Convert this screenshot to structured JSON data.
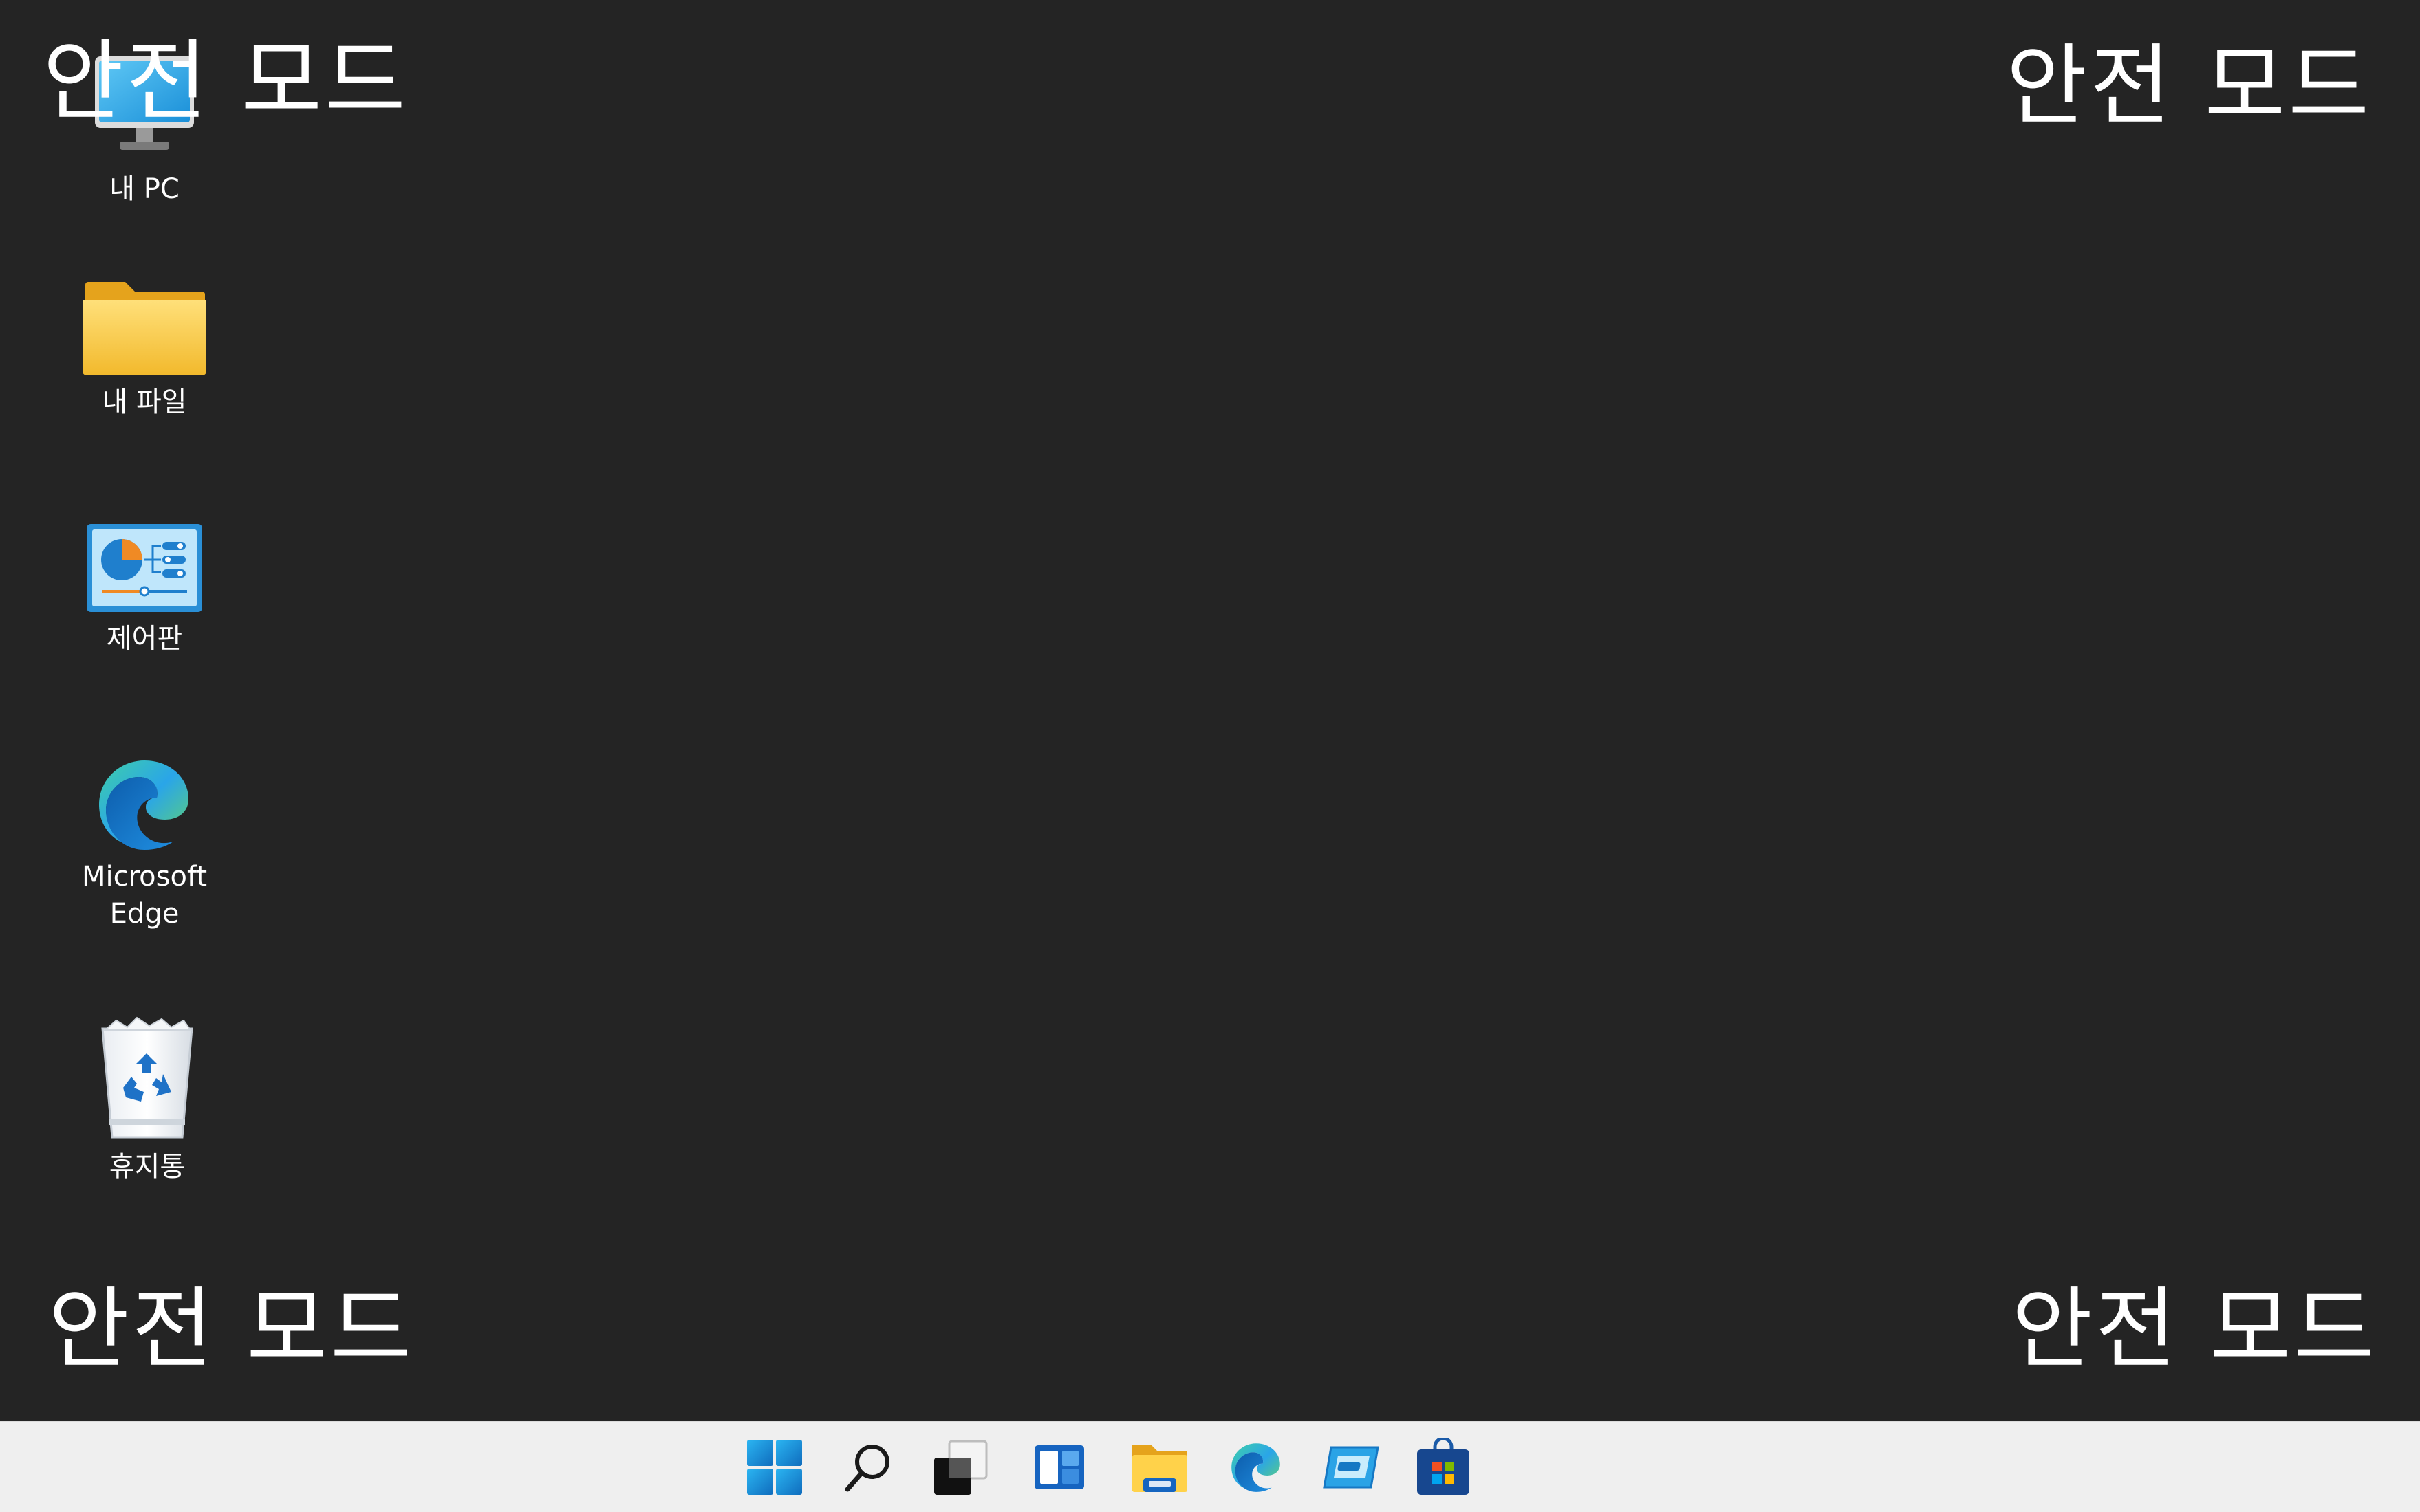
{
  "watermarks": {
    "top_left": "안전 모드",
    "top_right": "안전 모드",
    "bottom_left": "안전 모드",
    "bottom_right": "안전 모드"
  },
  "desktop_icons": [
    {
      "label": "내 PC",
      "icon": "computer-monitor-icon"
    },
    {
      "label": "내 파일",
      "icon": "folder-icon"
    },
    {
      "label": "제어판",
      "icon": "control-panel-icon"
    },
    {
      "label": "Microsoft Edge",
      "icon": "edge-icon"
    },
    {
      "label": "휴지통",
      "icon": "recycle-bin-icon"
    }
  ],
  "taskbar": {
    "items": [
      "start-icon",
      "search-icon",
      "task-view-icon",
      "widgets-icon",
      "file-explorer-icon",
      "edge-icon",
      "remote-desktop-icon",
      "store-icon"
    ]
  },
  "colors": {
    "desktop_background": "#242424",
    "taskbar_background": "#efefef",
    "watermark_text": "#ffffff",
    "accent_blue": "#0f6cbd",
    "folder_yellow": "#f5c542"
  }
}
